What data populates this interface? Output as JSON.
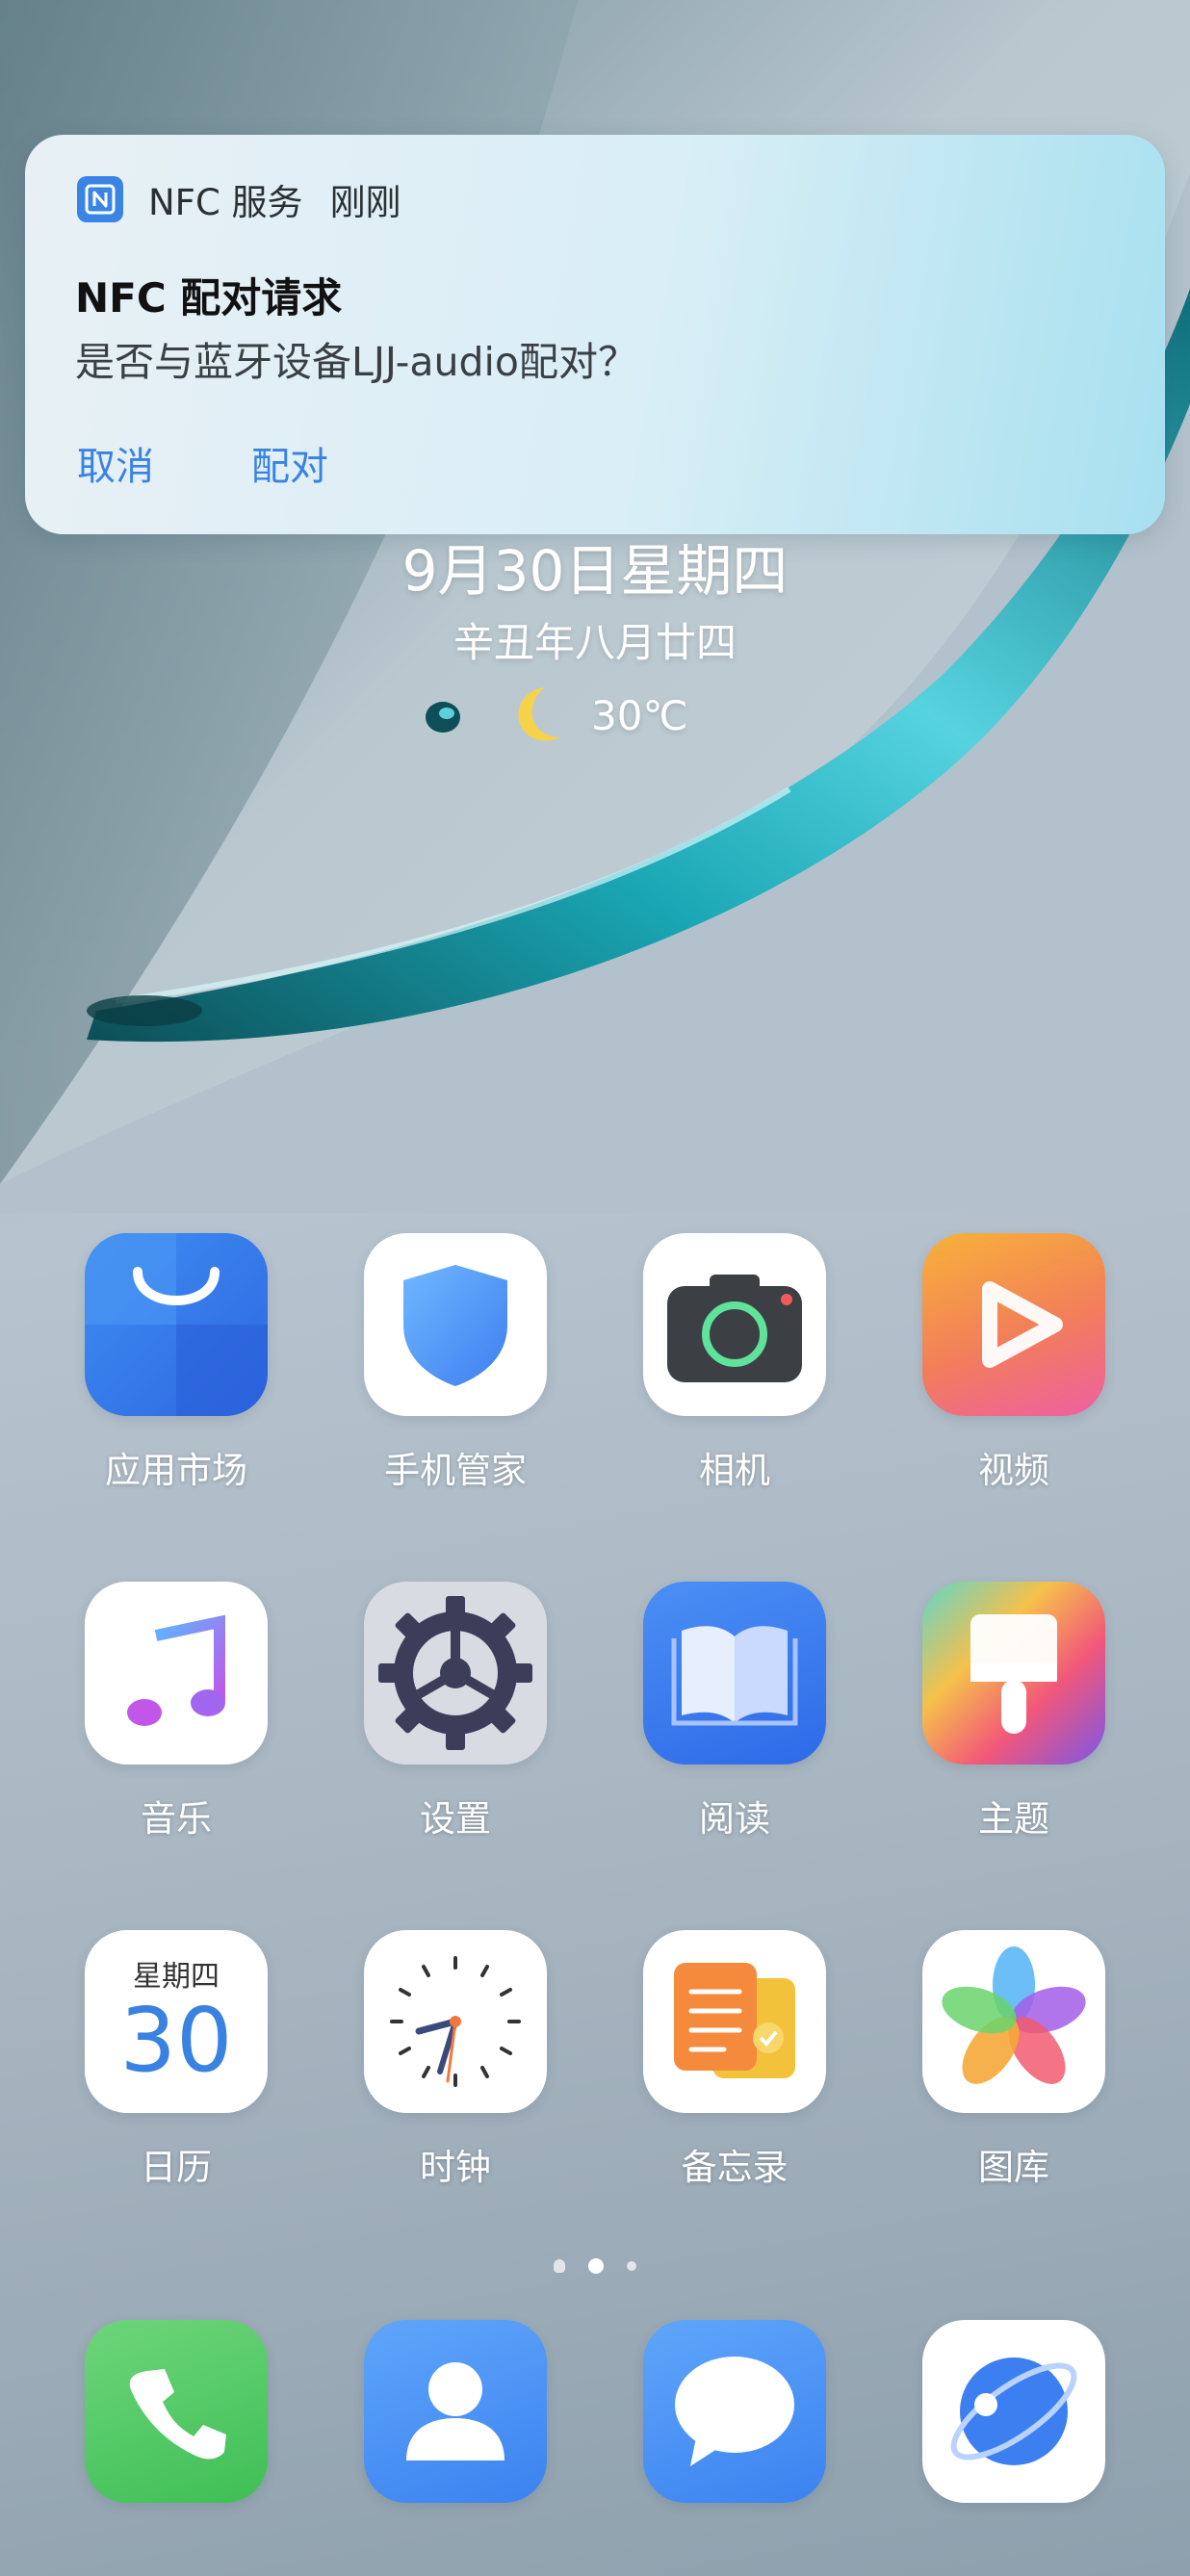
{
  "notification": {
    "app_name": "NFC 服务",
    "time": "刚刚",
    "title": "NFC 配对请求",
    "body": "是否与蓝牙设备LJJ-audio配对？",
    "cancel_label": "取消",
    "pair_label": "配对",
    "accent_color": "#3a82e2"
  },
  "lockinfo": {
    "date": "9月30日星期四",
    "lunar": "辛丑年八月廿四",
    "weather_icon": "moon-icon",
    "temperature": "30℃"
  },
  "apps": [
    {
      "label": "应用市场",
      "icon": "app-store-icon"
    },
    {
      "label": "手机管家",
      "icon": "shield-icon"
    },
    {
      "label": "相机",
      "icon": "camera-icon"
    },
    {
      "label": "视频",
      "icon": "video-play-icon"
    },
    {
      "label": "音乐",
      "icon": "music-note-icon"
    },
    {
      "label": "设置",
      "icon": "gear-icon"
    },
    {
      "label": "阅读",
      "icon": "book-icon"
    },
    {
      "label": "主题",
      "icon": "paintbrush-icon"
    },
    {
      "label": "日历",
      "icon": "calendar-icon",
      "weekday": "星期四",
      "day": "30"
    },
    {
      "label": "时钟",
      "icon": "clock-icon"
    },
    {
      "label": "备忘录",
      "icon": "notes-icon"
    },
    {
      "label": "图库",
      "icon": "gallery-icon"
    }
  ],
  "dock": [
    {
      "icon": "phone-icon"
    },
    {
      "icon": "contacts-icon"
    },
    {
      "icon": "messages-icon"
    },
    {
      "icon": "browser-icon"
    }
  ],
  "pages": {
    "count": 3,
    "current": 2
  }
}
